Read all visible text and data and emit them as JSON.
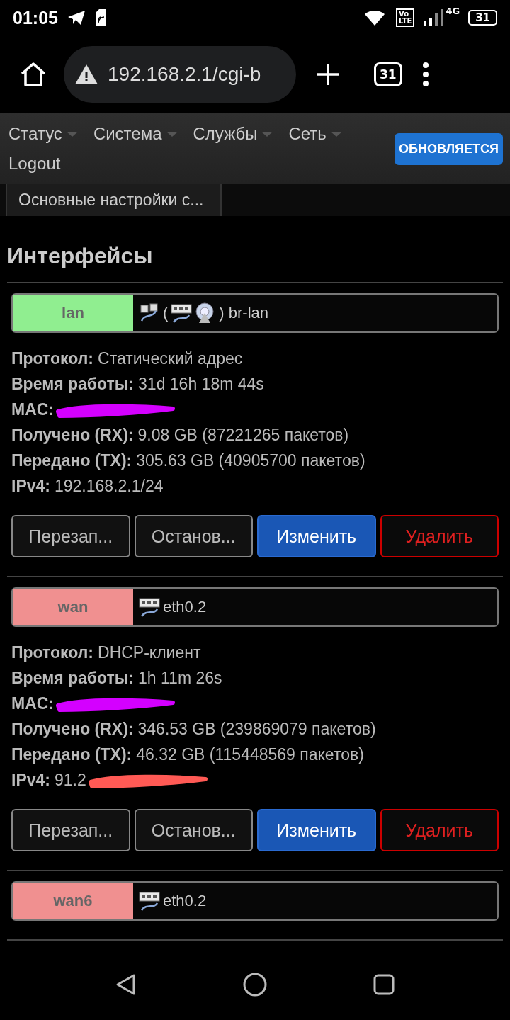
{
  "status_bar": {
    "time": "01:05",
    "volte_top": "Vo",
    "volte_bottom": "LTE",
    "network": "4G",
    "battery": "31"
  },
  "browser": {
    "url": "192.168.2.1/cgi-b",
    "tab_count": "31"
  },
  "menu": [
    {
      "label": "Статус",
      "dropdown": true
    },
    {
      "label": "Система",
      "dropdown": true
    },
    {
      "label": "Службы",
      "dropdown": true
    },
    {
      "label": "Сеть",
      "dropdown": true
    },
    {
      "label": "Logout",
      "dropdown": false
    }
  ],
  "refresh_button": "ОБНОВЛЯЕТСЯ",
  "tabs": [
    {
      "label": "Основные настройки с..."
    }
  ],
  "heading": "Интерфейсы",
  "interfaces": [
    {
      "name": "lan",
      "color": "#90ee90",
      "device": [
        {
          "kind": "bridge"
        },
        {
          "kind": "text",
          "text": "("
        },
        {
          "kind": "ethernet"
        },
        {
          "kind": "wireless"
        },
        {
          "kind": "text",
          "text": ") br-lan"
        }
      ],
      "details": [
        {
          "label": "Протокол:",
          "value": "Статический адрес"
        },
        {
          "label": "Время работы:",
          "value": "31d 16h 18m 44s"
        },
        {
          "label": "MAC:",
          "color": "#d400ff"
        },
        {
          "label": "Получено (RX):",
          "value": "9.08 GB (87221265 пакетов)"
        },
        {
          "label": "Передано (TX):",
          "value": "305.63 GB (40905700 пакетов)"
        },
        {
          "label": "IPv4:",
          "value": "192.168.2.1/24"
        }
      ],
      "buttons": [
        {
          "label": "Перезап...",
          "kind": "neutral"
        },
        {
          "label": "Останов...",
          "kind": "neutral"
        },
        {
          "label": "Изменить",
          "kind": "primary"
        },
        {
          "label": "Удалить",
          "kind": "danger"
        }
      ]
    },
    {
      "name": "wan",
      "color": "#f09090",
      "device": [
        {
          "kind": "ethernet"
        },
        {
          "kind": "text",
          "text": "eth0.2"
        }
      ],
      "details": [
        {
          "label": "Протокол:",
          "value": "DHCP-клиент"
        },
        {
          "label": "Время работы:",
          "value": "1h 11m 26s"
        },
        {
          "label": "MAC:",
          "color": "#d400ff"
        },
        {
          "label": "Получено (RX):",
          "value": "346.53 GB (239869079 пакетов)"
        },
        {
          "label": "Передано (TX):",
          "value": "46.32 GB (115448569 пакетов)"
        },
        {
          "label": "IPv4:",
          "value": "91.2",
          "color": "#ff5a55"
        }
      ],
      "buttons": [
        {
          "label": "Перезап...",
          "kind": "neutral"
        },
        {
          "label": "Останов...",
          "kind": "neutral"
        },
        {
          "label": "Изменить",
          "kind": "primary"
        },
        {
          "label": "Удалить",
          "kind": "danger"
        }
      ]
    },
    {
      "name": "wan6",
      "color": "#f09090",
      "device": [
        {
          "kind": "ethernet"
        },
        {
          "kind": "text",
          "text": "eth0.2"
        }
      ]
    }
  ]
}
